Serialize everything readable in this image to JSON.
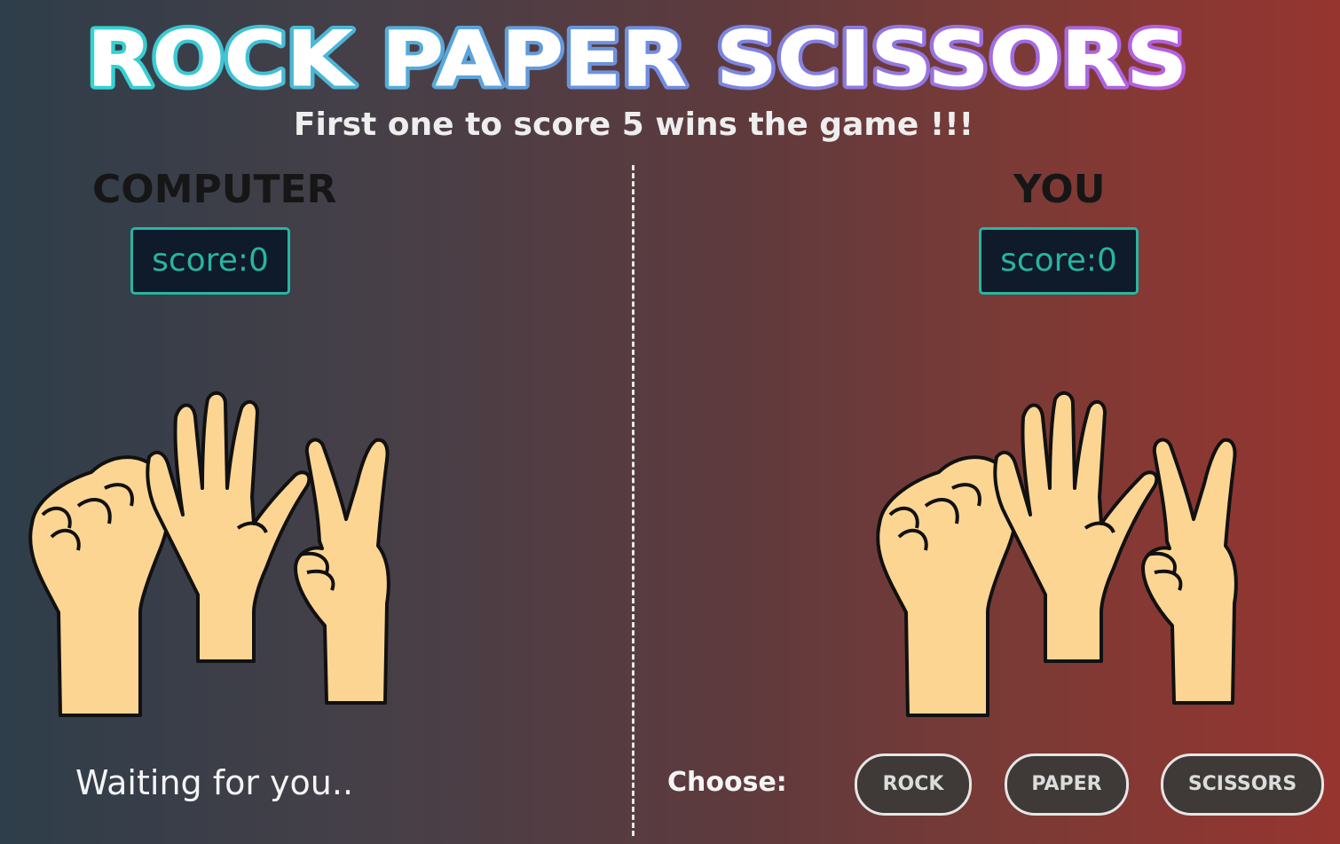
{
  "title": {
    "text": "ROCK PAPER SCISSORS",
    "gradient_start": "#2fd6d0",
    "gradient_mid": "#6f8ee0",
    "gradient_end": "#b85de0"
  },
  "subtitle": "First one to score 5 wins the game !!!",
  "computer": {
    "name": "COMPUTER",
    "score_label": "score:0",
    "status": "Waiting for you.."
  },
  "player": {
    "name": "YOU",
    "score_label": "score:0"
  },
  "controls": {
    "choose_label": "Choose:",
    "rock_label": "ROCK",
    "paper_label": "PAPER",
    "scissors_label": "SCISSORS"
  },
  "colors": {
    "score_border": "#29b5a1",
    "score_text": "#27b5a0",
    "score_bg": "#0f1a2b",
    "button_bg": "#3f3a38",
    "skin": "#fdd593"
  },
  "icons": {
    "hands_image": "rock-paper-scissors-hands-icon"
  }
}
